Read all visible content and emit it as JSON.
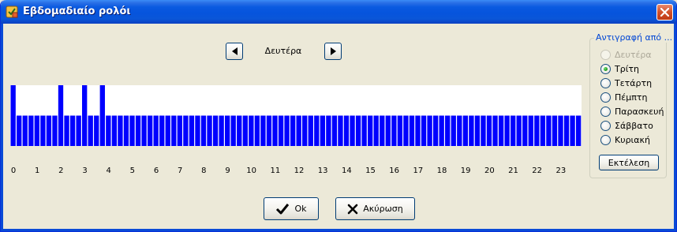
{
  "window": {
    "title": "Εβδομαδιαίο ρολόι",
    "accent": "#0A5AE0"
  },
  "navigation": {
    "prev_icon": "triangle-left-icon",
    "next_icon": "triangle-right-icon",
    "day": "Δευτέρα"
  },
  "chart_data": {
    "type": "bar",
    "title": "",
    "xlabel": "",
    "ylabel": "",
    "x_ticks": [
      "0",
      "1",
      "2",
      "3",
      "4",
      "5",
      "6",
      "7",
      "8",
      "9",
      "10",
      "11",
      "12",
      "13",
      "14",
      "15",
      "16",
      "17",
      "18",
      "19",
      "20",
      "21",
      "22",
      "23"
    ],
    "slots_per_hour": 4,
    "slot_count": 96,
    "bar_color": "#0000FF",
    "values": [
      2,
      1,
      1,
      1,
      1,
      1,
      1,
      1,
      2,
      1,
      1,
      1,
      2,
      1,
      1,
      2,
      1,
      1,
      1,
      1,
      1,
      1,
      1,
      1,
      1,
      1,
      1,
      1,
      1,
      1,
      1,
      1,
      1,
      1,
      1,
      1,
      1,
      1,
      1,
      1,
      1,
      1,
      1,
      1,
      1,
      1,
      1,
      1,
      1,
      1,
      1,
      1,
      1,
      1,
      1,
      1,
      1,
      1,
      1,
      1,
      1,
      1,
      1,
      1,
      1,
      1,
      1,
      1,
      1,
      1,
      1,
      1,
      1,
      1,
      1,
      1,
      1,
      1,
      1,
      1,
      1,
      1,
      1,
      1,
      1,
      1,
      1,
      1,
      1,
      1,
      1,
      1,
      1,
      1,
      1,
      1
    ],
    "ylim": [
      0,
      2
    ]
  },
  "copy_from": {
    "title": "Αντιγραφή από ...",
    "options": [
      {
        "label": "Δευτέρα",
        "disabled": true,
        "checked": false
      },
      {
        "label": "Τρίτη",
        "disabled": false,
        "checked": true
      },
      {
        "label": "Τετάρτη",
        "disabled": false,
        "checked": false
      },
      {
        "label": "Πέμπτη",
        "disabled": false,
        "checked": false
      },
      {
        "label": "Παρασκευή",
        "disabled": false,
        "checked": false
      },
      {
        "label": "Σάββατο",
        "disabled": false,
        "checked": false
      },
      {
        "label": "Κυριακή",
        "disabled": false,
        "checked": false
      }
    ],
    "execute_label": "Εκτέλεση"
  },
  "footer": {
    "ok_label": "Ok",
    "ok_icon": "checkmark-icon",
    "cancel_label": "Ακύρωση",
    "cancel_icon": "x-icon"
  }
}
